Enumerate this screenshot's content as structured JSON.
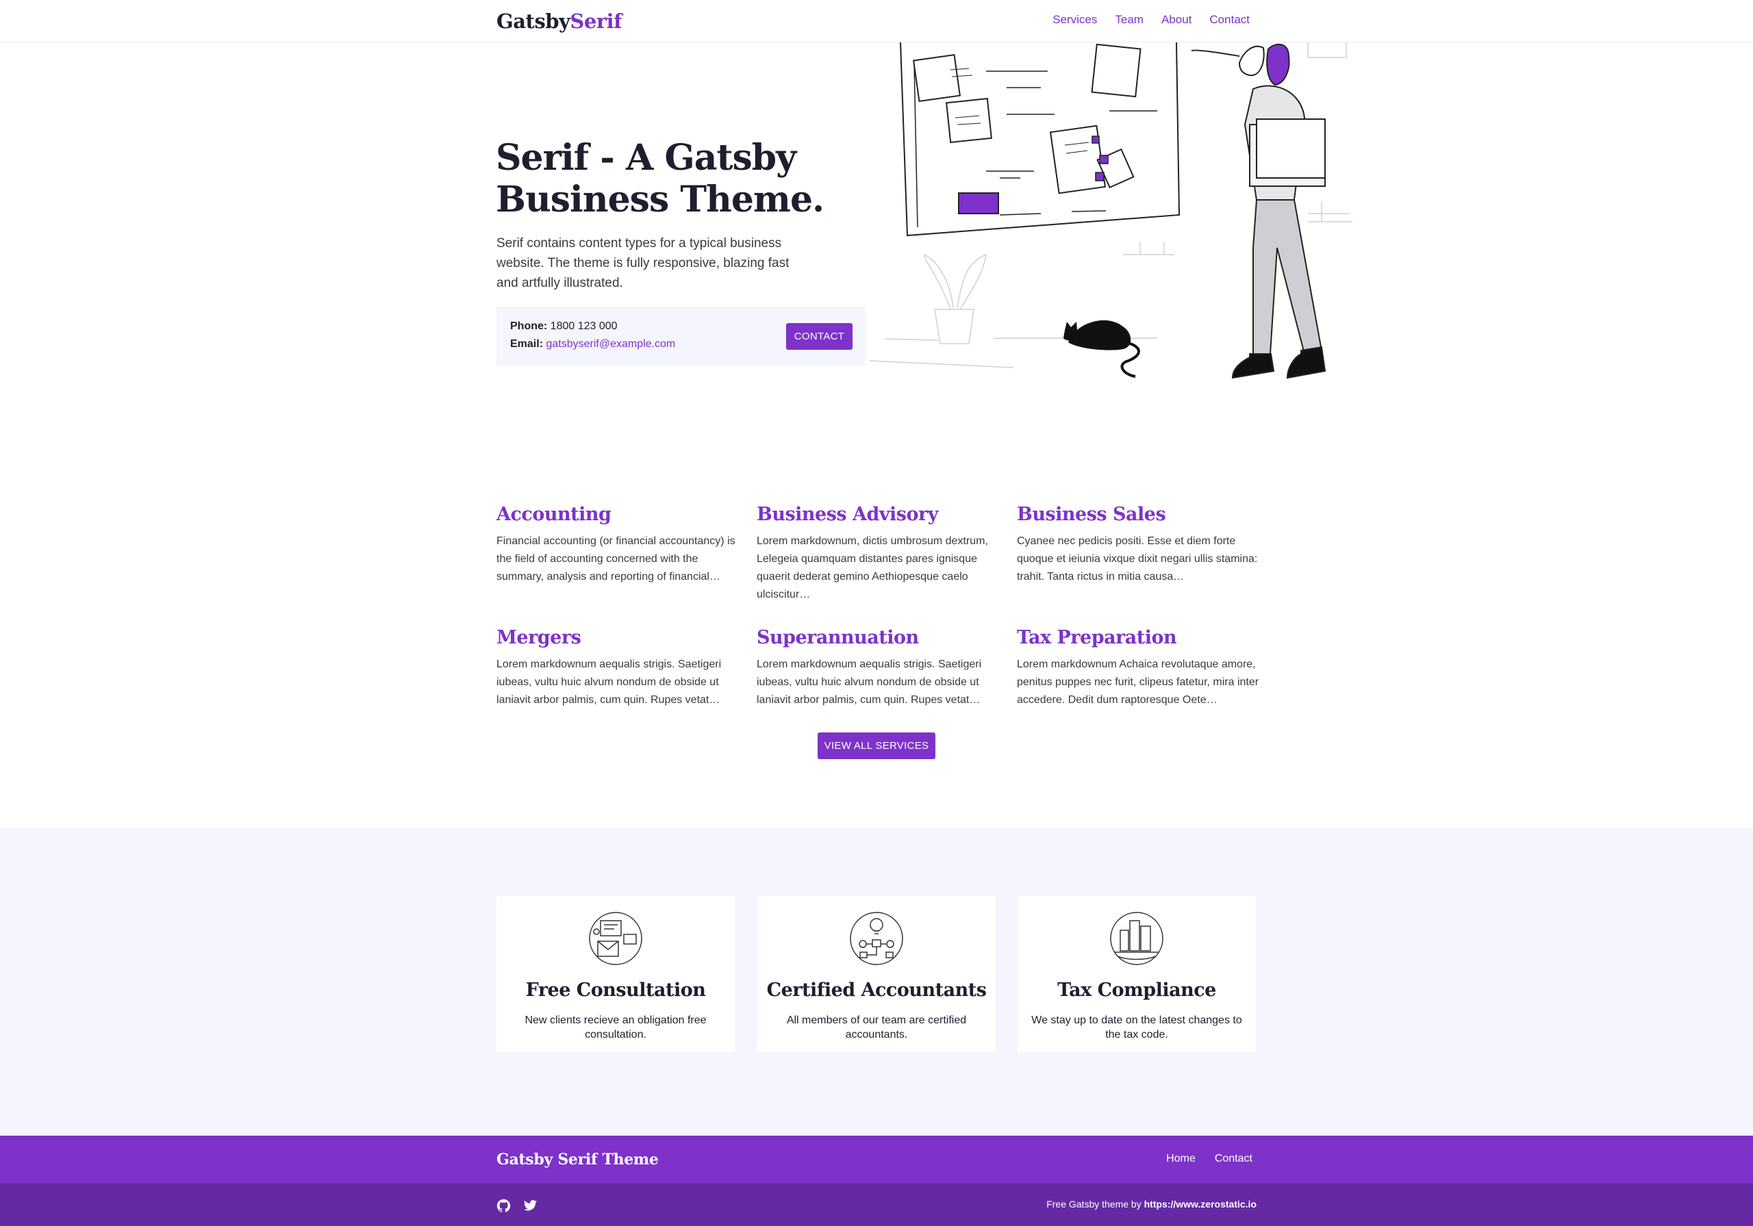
{
  "brand": {
    "logo_part1": "Gatsby",
    "logo_part2": "Serif"
  },
  "nav": {
    "items": [
      {
        "label": "Services"
      },
      {
        "label": "Team"
      },
      {
        "label": "About"
      },
      {
        "label": "Contact"
      }
    ]
  },
  "hero": {
    "title_line1": "Serif - A Gatsby",
    "title_line2": "Business Theme.",
    "description": "Serif contains content types for a typical business website. The theme is fully responsive, blazing fast and artfully illustrated.",
    "phone_label": "Phone:",
    "phone_value": "1800 123 000",
    "email_label": "Email:",
    "email_value": "gatsbyserif@example.com",
    "contact_button": "Contact"
  },
  "services": {
    "items": [
      {
        "title": "Accounting",
        "text": "Financial accounting (or financial accountancy) is the field of accounting concerned with the summary, analysis and reporting of financial…"
      },
      {
        "title": "Business Advisory",
        "text": "Lorem markdownum, dictis umbrosum dextrum, Lelegeia quamquam distantes pares ignisque quaerit dederat gemino Aethiopesque caelo ulciscitur…"
      },
      {
        "title": "Business Sales",
        "text": "Cyanee nec pedicis positi. Esse et diem forte quoque et ieiunia vixque dixit negari ullis stamina: trahit. Tanta rictus in mitia causa…"
      },
      {
        "title": "Mergers",
        "text": "Lorem markdownum aequalis strigis. Saetigeri iubeas, vultu huic alvum nondum de obside ut laniavit arbor palmis, cum quin. Rupes vetat…"
      },
      {
        "title": "Superannuation",
        "text": "Lorem markdownum aequalis strigis. Saetigeri iubeas, vultu huic alvum nondum de obside ut laniavit arbor palmis, cum quin. Rupes vetat…"
      },
      {
        "title": "Tax Preparation",
        "text": "Lorem markdownum Achaica revolutaque amore, penitus puppes nec furit, clipeus fatetur, mira inter accedere. Dedit dum raptoresque Oete…"
      }
    ],
    "view_all_button": "View All Services"
  },
  "features": [
    {
      "icon": "consultation-icon",
      "title": "Free Consultation",
      "text": "New clients recieve an obligation free consultation."
    },
    {
      "icon": "accountant-icon",
      "title": "Certified Accountants",
      "text": "All members of our team are certified accountants."
    },
    {
      "icon": "tax-compliance-icon",
      "title": "Tax Compliance",
      "text": "We stay up to date on the latest changes to the tax code."
    }
  ],
  "footer": {
    "title": "Gatsby Serif Theme",
    "nav": [
      {
        "label": "Home"
      },
      {
        "label": "Contact"
      }
    ],
    "credit_prefix": "Free Gatsby theme by",
    "credit_link": "https://www.zerostatic.io",
    "social": [
      "github-icon",
      "twitter-icon"
    ]
  },
  "colors": {
    "accent": "#7e32c9",
    "accent_dark": "#652aa3",
    "heading": "#1e1f2e",
    "band_bg": "#f5f6fd"
  }
}
